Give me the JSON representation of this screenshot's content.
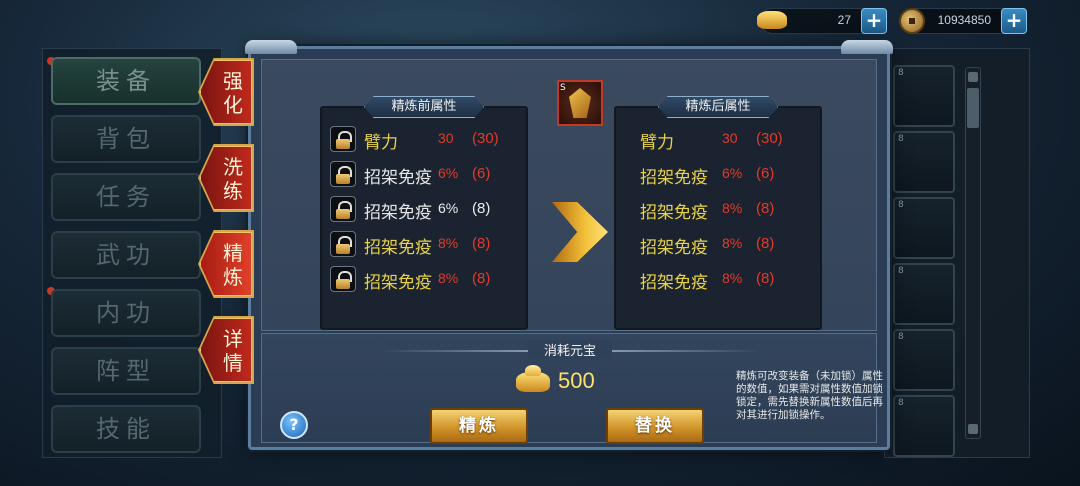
{
  "currency": {
    "ingot_value": "27",
    "coin_value": "10934850",
    "plus": "+"
  },
  "menu": {
    "items": [
      {
        "label": "装备",
        "active": true
      },
      {
        "label": "背包"
      },
      {
        "label": "任务"
      },
      {
        "label": "武功"
      },
      {
        "label": "内功"
      },
      {
        "label": "阵型"
      },
      {
        "label": "技能"
      }
    ]
  },
  "tabs": [
    {
      "label": "强化"
    },
    {
      "label": "洗练"
    },
    {
      "label": "精炼",
      "active": true
    },
    {
      "label": "详情"
    }
  ],
  "dialog": {
    "before_title": "精炼前属性",
    "after_title": "精炼后属性",
    "item_badge": "S",
    "before_attrs": [
      {
        "name": "臂力",
        "value": "30",
        "max": "(30)"
      },
      {
        "name": "招架免疫",
        "value": "6%",
        "max": "(6)"
      },
      {
        "name": "招架免疫",
        "value": "6%",
        "max": "(8)"
      },
      {
        "name": "招架免疫",
        "value": "8%",
        "max": "(8)"
      },
      {
        "name": "招架免疫",
        "value": "8%",
        "max": "(8)"
      }
    ],
    "after_attrs": [
      {
        "name": "臂力",
        "value": "30",
        "max": "(30)"
      },
      {
        "name": "招架免疫",
        "value": "6%",
        "max": "(6)"
      },
      {
        "name": "招架免疫",
        "value": "8%",
        "max": "(8)"
      },
      {
        "name": "招架免疫",
        "value": "8%",
        "max": "(8)"
      },
      {
        "name": "招架免疫",
        "value": "8%",
        "max": "(8)"
      }
    ],
    "cost_label": "消耗元宝",
    "cost_value": "500",
    "refine_button": "精炼",
    "replace_button": "替换",
    "help": "?",
    "hint": "精炼可改变装备（未加锁）属性的数值，如果需对属性数值加锁锁定，需先替换新属性数值后再对其进行加锁操作。"
  },
  "inventory": {
    "slot_numbers": [
      "8",
      "8",
      "8",
      "8",
      "8",
      "8"
    ]
  }
}
